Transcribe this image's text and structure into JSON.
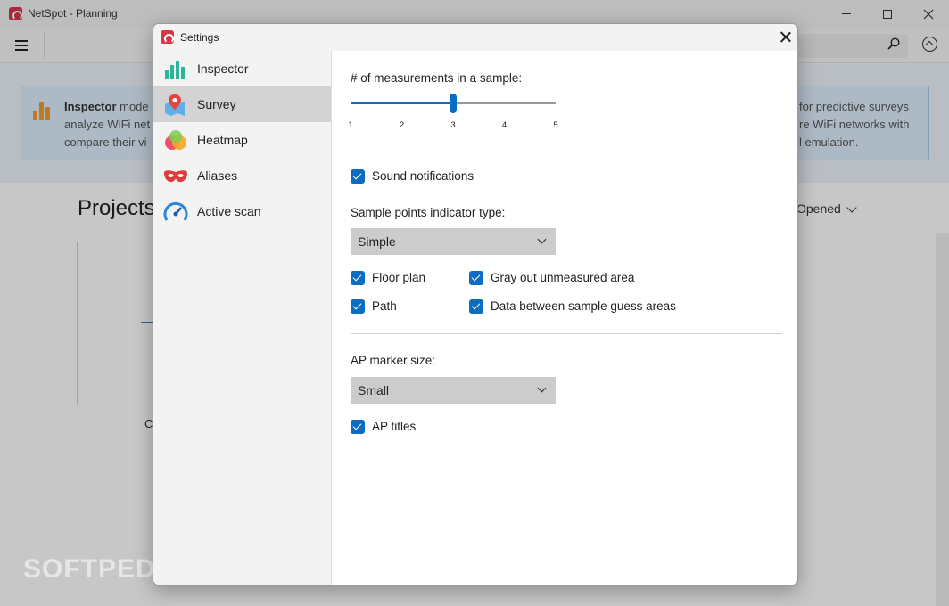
{
  "app": {
    "title": "NetSpot - Planning",
    "banner": {
      "line1_bold": "Inspector",
      "line1_rest": " mode",
      "line2": "analyze WiFi net",
      "line3": "compare their vi",
      "right1": "for predictive surveys",
      "right2": "re WiFi networks with",
      "right3": "l emulation."
    },
    "projects_title": "Projects",
    "sort_label": "Opened",
    "card_caption": "C"
  },
  "dialog": {
    "title": "Settings",
    "nav": [
      {
        "label": "Inspector",
        "icon": "inspector-bars-icon"
      },
      {
        "label": "Survey",
        "icon": "survey-map-pin-icon"
      },
      {
        "label": "Heatmap",
        "icon": "heatmap-blobs-icon"
      },
      {
        "label": "Aliases",
        "icon": "aliases-mask-icon"
      },
      {
        "label": "Active scan",
        "icon": "active-scan-gauge-icon"
      }
    ],
    "active_nav": "Survey",
    "survey": {
      "measurements_label": "# of measurements in a sample:",
      "slider": {
        "min": 1,
        "max": 5,
        "value": 3,
        "ticks": [
          "1",
          "2",
          "3",
          "4",
          "5"
        ]
      },
      "sound_notifications": {
        "label": "Sound notifications",
        "checked": true
      },
      "indicator_type_label": "Sample points indicator type:",
      "indicator_type_value": "Simple",
      "floor_plan": {
        "label": "Floor plan",
        "checked": true
      },
      "gray_out": {
        "label": "Gray out unmeasured area",
        "checked": true
      },
      "path": {
        "label": "Path",
        "checked": true
      },
      "data_between": {
        "label": "Data between sample guess areas",
        "checked": true
      },
      "ap_marker_size_label": "AP marker size:",
      "ap_marker_size_value": "Small",
      "ap_titles": {
        "label": "AP titles",
        "checked": true
      }
    }
  },
  "watermark": "SOFTPEDIA",
  "colors": {
    "accent": "#0a6cc2",
    "brand": "#d9344a",
    "banner_icon": "#f59c2b"
  }
}
